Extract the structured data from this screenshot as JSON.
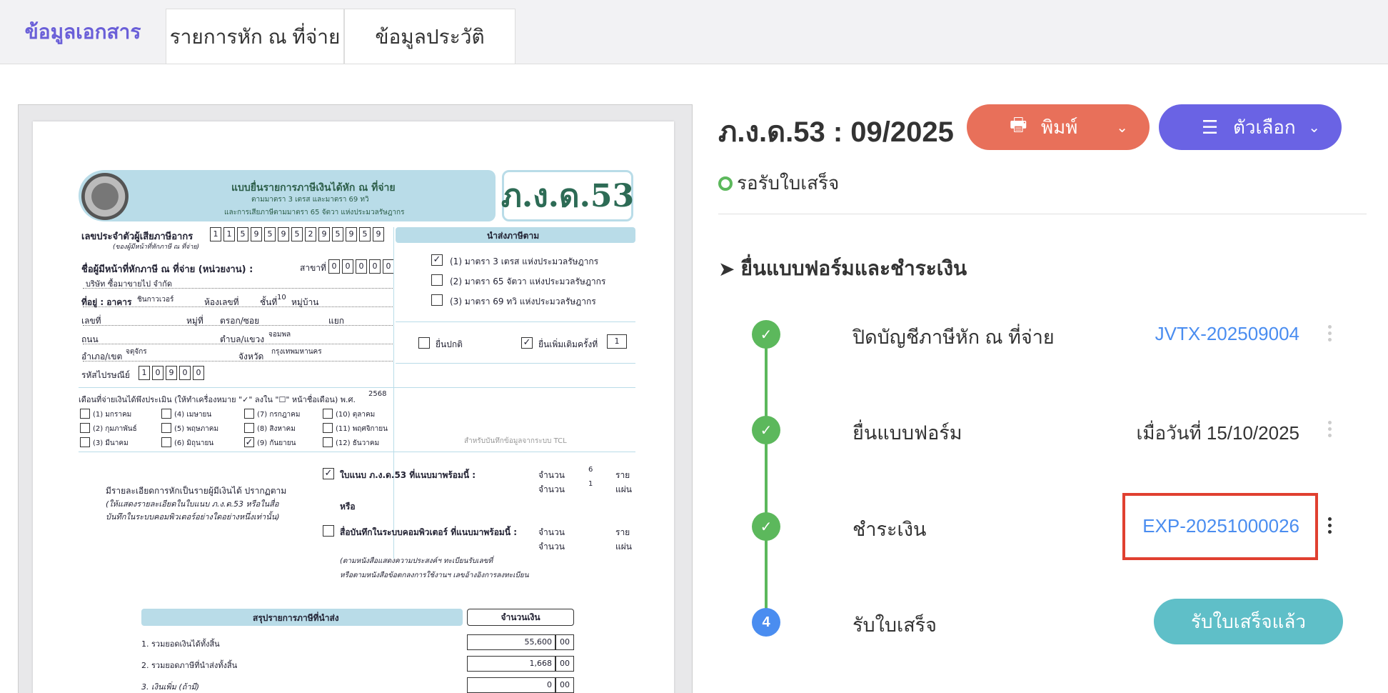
{
  "tabs": [
    {
      "label": "ข้อมูลเอกสาร",
      "active": true
    },
    {
      "label": "รายการหัก ณ ที่จ่าย",
      "active": false
    },
    {
      "label": "ข้อมูลประวัติ",
      "active": false
    }
  ],
  "document": {
    "form_badge": "ภ.ง.ด.53",
    "header_title": "แบบยื่นรายการภาษีเงินได้หัก ณ ที่จ่าย",
    "header_sub1": "ตามมาตรา 3 เตรส และมาตรา 69 ทวิ",
    "header_sub2": "และการเสียภาษีตามมาตรา 65 จัตวา แห่งประมวลรัษฎากร",
    "tax_id_label": "เลขประจำตัวผู้เสียภาษีอากร",
    "tax_id_sub": "(ของผู้มีหน้าที่หักภาษี ณ ที่จ่าย)",
    "tax_id_digits": [
      "1",
      "1",
      "5",
      "9",
      "5",
      "9",
      "5",
      "2",
      "9",
      "5",
      "9",
      "5",
      "9"
    ],
    "submit_band": "นำส่งภาษีตาม",
    "section_options": [
      "(1) มาตรา 3 เตรส แห่งประมวลรัษฎากร",
      "(2) มาตรา 65 จัตวา แห่งประมวลรัษฎากร",
      "(3) มาตรา 69 ทวิ แห่งประมวลรัษฎากร"
    ],
    "payer_label": "ชื่อผู้มีหน้าที่หักภาษี ณ ที่จ่าย (หน่วยงาน) :",
    "branch_label": "สาขาที่",
    "branch_digits": [
      "0",
      "0",
      "0",
      "0",
      "0"
    ],
    "company_name": "บริษัท ซื้อมาขายไป จำกัด",
    "address_label": "ที่อยู่ : อาคาร",
    "building": "ชินกาวเวอร์",
    "room_label": "ห้องเลขที่",
    "floor_label": "ชั้นที่",
    "floor": "10",
    "village_label": "หมู่บ้าน",
    "no_label": "เลขที่",
    "moo_label": "หมู่ที่",
    "soi_label": "ตรอก/ซอย",
    "yaek_label": "แยก",
    "road_label": "ถนน",
    "subdistrict_label": "ตำบล/แขวง",
    "subdistrict": "จอมพล",
    "district_label": "อำเภอ/เขต",
    "district": "จตุจักร",
    "province_label": "จังหวัด",
    "province": "กรุงเทพมหานคร",
    "postcode_label": "รหัสไปรษณีย์",
    "postcode_digits": [
      "1",
      "0",
      "9",
      "0",
      "0"
    ],
    "filing_normal": "ยื่นปกติ",
    "filing_extra": "ยื่นเพิ่มเติมครั้งที่",
    "filing_extra_no": "1",
    "month_label": "เดือนที่จ่ายเงินได้พึงประเมิน (ให้ทำเครื่องหมาย \"✓\" ลงใน \"☐\" หน้าชื่อเดือน) พ.ศ.",
    "year": "2568",
    "months": [
      "(1) มกราคม",
      "(4) เมษายน",
      "(7) กรกฎาคม",
      "(10) ตุลาคม",
      "(2) กุมภาพันธ์",
      "(5) พฤษภาคม",
      "(8) สิงหาคม",
      "(11) พฤศจิกายน",
      "(3) มีนาคม",
      "(6) มิถุนายน",
      "(9) กันยายน",
      "(12) ธันวาคม"
    ],
    "tcl_note": "สำหรับบันทึกข้อมูลจากระบบ TCL",
    "attach_label": "ใบแนบ ภ.ง.ด.53 ที่แนบมาพร้อมนี้ :",
    "count_label": "จำนวน",
    "count_items": "6",
    "unit_items": "ราย",
    "count_sheets": "1",
    "unit_sheets": "แผ่น",
    "detail_text": "มีรายละเอียดการหักเป็นรายผู้มีเงินได้ ปรากฏตาม",
    "detail_italic1": "(ให้แสดงรายละเอียดในใบแนบ ภ.ง.ด.53 หรือในสื่อ",
    "detail_italic2": "บันทึกในระบบคอมพิวเตอร์อย่างใดอย่างหนึ่งเท่านั้น)",
    "or_label": "หรือ",
    "media_label": "สื่อบันทึกในระบบคอมพิวเตอร์ ที่แนบมาพร้อมนี้ :",
    "media_note1": "(ตามหนังสือแสดงความประสงค์ฯ ทะเบียนรับเลขที่",
    "media_note2": "หรือตามหนังสือข้อตกลงการใช้งานฯ เลขอ้างอิงการลงทะเบียน",
    "summary_band": "สรุปรายการภาษีที่นำส่ง",
    "amount_header": "จำนวนเงิน",
    "summary_rows": [
      {
        "label": "1. รวมยอดเงินได้ทั้งสิ้น",
        "amount": "55,600",
        "satang": "00"
      },
      {
        "label": "2. รวมยอดภาษีที่นำส่งทั้งสิ้น",
        "amount": "1,668",
        "satang": "00"
      },
      {
        "label": "3. เงินเพิ่ม (ถ้ามี)",
        "amount": "0",
        "satang": "00"
      }
    ]
  },
  "header": {
    "title": "ภ.ง.ด.53 : 09/2025",
    "print_label": "พิมพ์",
    "options_label": "ตัวเลือก",
    "status": "รอรับใบเสร็จ"
  },
  "section_title": "ยื่นแบบฟอร์มและชำระเงิน",
  "steps": [
    {
      "label": "ปิดบัญชีภาษีหัก ณ ที่จ่าย",
      "value": "JVTX-202509004",
      "state": "done"
    },
    {
      "label": "ยื่นแบบฟอร์ม",
      "value": "เมื่อวันที่ 15/10/2025",
      "state": "done"
    },
    {
      "label": "ชำระเงิน",
      "value": "EXP-20251000026",
      "state": "done"
    },
    {
      "label": "รับใบเสร็จ",
      "value": "รับใบเสร็จแล้ว",
      "state": "4"
    }
  ],
  "colors": {
    "accent": "#6a5fd8",
    "print_button": "#e8705a",
    "options_button": "#6a63e4",
    "success": "#5cb85c",
    "link": "#4a8df0",
    "highlight": "#e04030",
    "receive_button": "#5fbfc8"
  }
}
